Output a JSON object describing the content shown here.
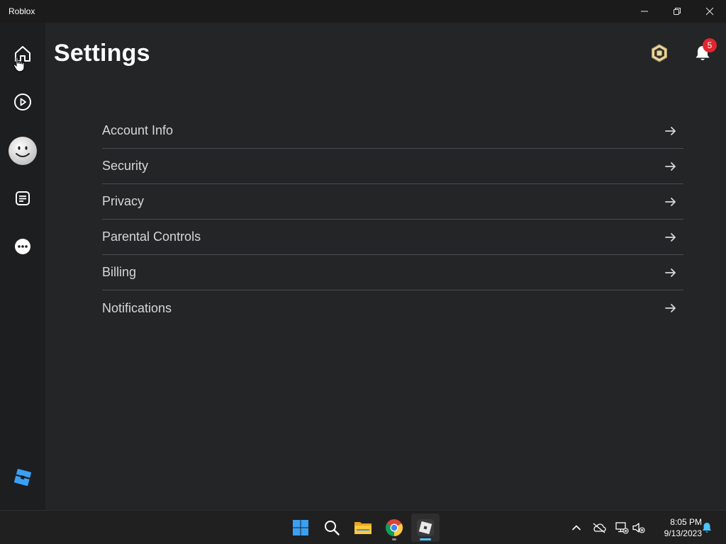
{
  "window": {
    "title": "Roblox"
  },
  "header": {
    "title": "Settings",
    "notification_count": "5"
  },
  "settings": {
    "items": [
      {
        "label": "Account Info"
      },
      {
        "label": "Security"
      },
      {
        "label": "Privacy"
      },
      {
        "label": "Parental Controls"
      },
      {
        "label": "Billing"
      },
      {
        "label": "Notifications"
      }
    ]
  },
  "sidebar": {
    "items": [
      "home-icon",
      "play-icon",
      "avatar",
      "chat-icon",
      "more-icon"
    ],
    "logo": "roblox-logo-icon"
  },
  "taskbar": {
    "apps": [
      "windows-start-icon",
      "search-icon",
      "file-explorer-icon",
      "chrome-icon",
      "roblox-app-icon"
    ],
    "time": "8:05 PM",
    "date": "9/13/2023"
  },
  "colors": {
    "background": "#232527",
    "sidebar": "#1d1e20",
    "badge": "#e1262d",
    "accent": "#4cc2ff"
  }
}
